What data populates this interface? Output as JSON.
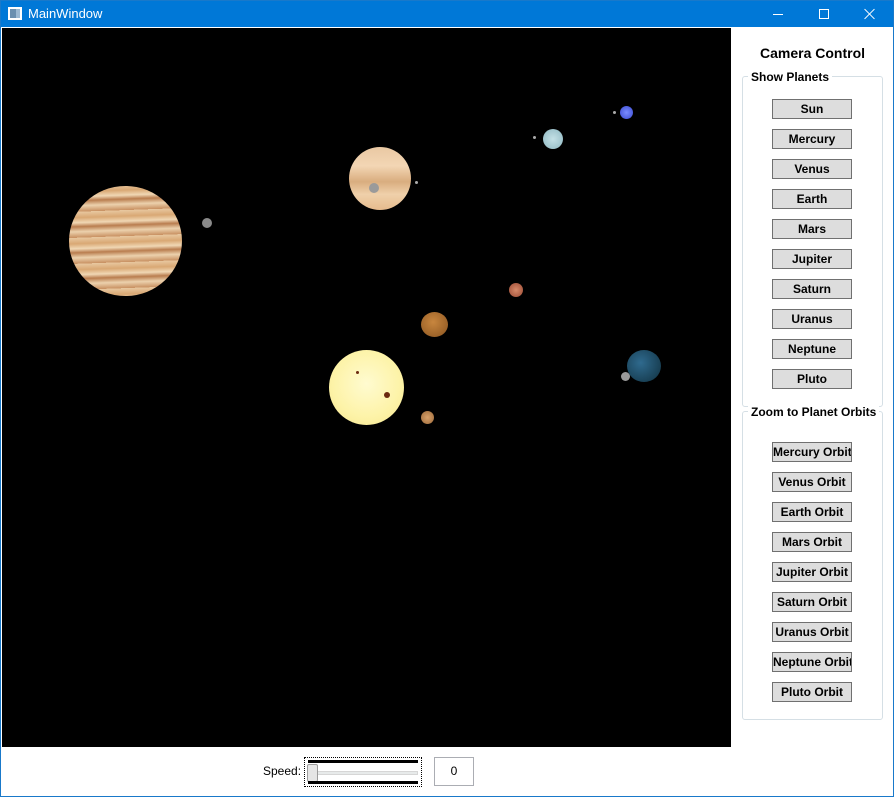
{
  "window": {
    "title": "MainWindow"
  },
  "panel": {
    "title": "Camera Control",
    "show_planets": {
      "header": "Show Planets",
      "buttons": [
        "Sun",
        "Mercury",
        "Venus",
        "Earth",
        "Mars",
        "Jupiter",
        "Saturn",
        "Uranus",
        "Neptune",
        "Pluto"
      ]
    },
    "zoom_orbits": {
      "header": "Zoom to Planet Orbits",
      "buttons": [
        "Mercury Orbit",
        "Venus Orbit",
        "Earth Orbit",
        "Mars Orbit",
        "Jupiter Orbit",
        "Saturn Orbit",
        "Uranus Orbit",
        "Neptune Orbit",
        "Pluto Orbit"
      ]
    }
  },
  "speed": {
    "label": "Speed:",
    "value": "0",
    "slider_fraction": 0
  },
  "colors": {
    "titlebar": "#0078d7",
    "viewport": "#000000",
    "button_face": "#dddddd"
  }
}
